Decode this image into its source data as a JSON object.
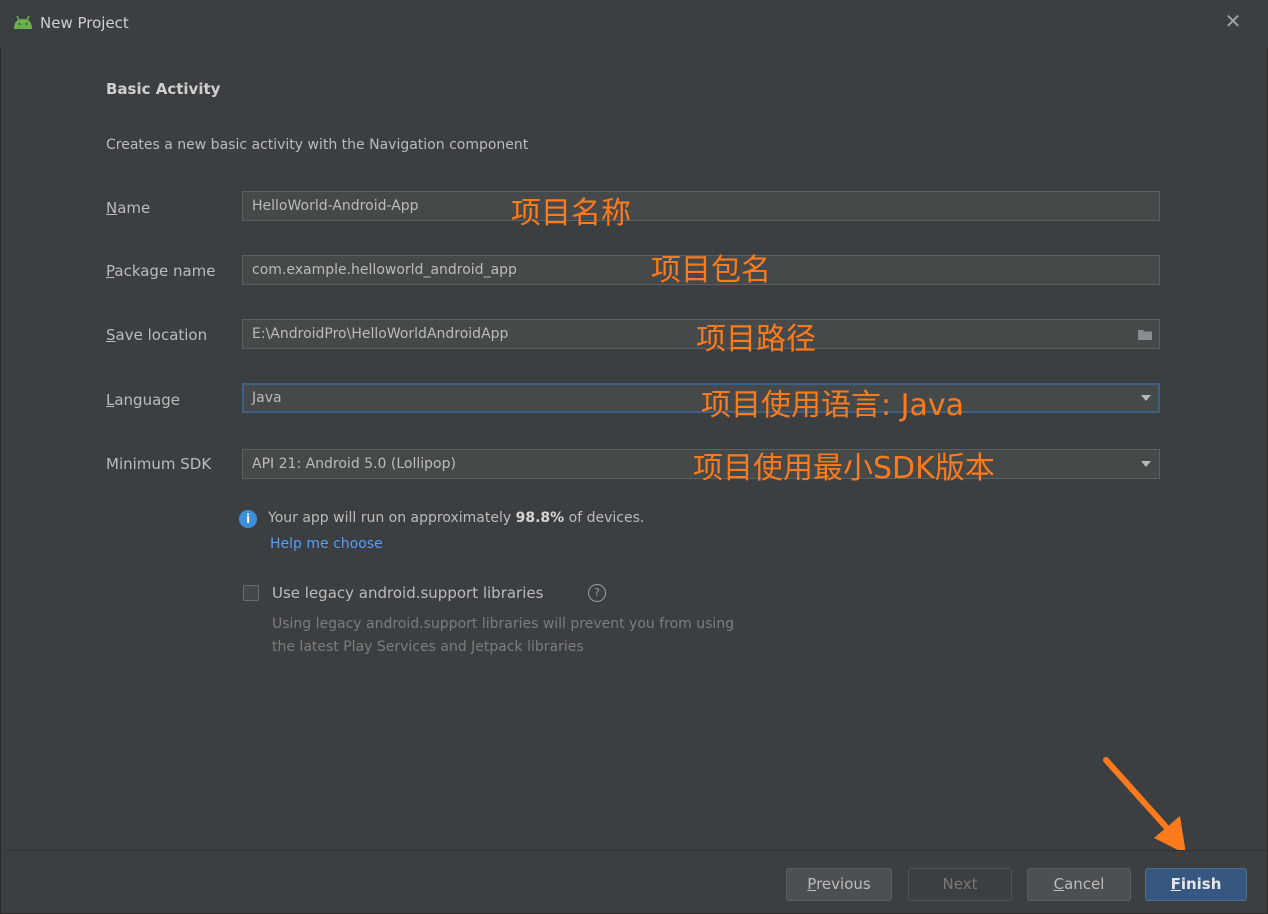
{
  "window": {
    "title": "New Project",
    "close_glyph": "✕"
  },
  "header": {
    "section_title": "Basic Activity",
    "description": "Creates a new basic activity with the Navigation component"
  },
  "form": {
    "name": {
      "label_key": "N",
      "label_rest": "ame",
      "value": "HelloWorld-Android-App"
    },
    "package": {
      "label_key": "P",
      "label_rest": "ackage name",
      "value": "com.example.helloworld_android_app"
    },
    "save_location": {
      "label_key": "S",
      "label_rest": "ave location",
      "value": "E:\\AndroidPro\\HelloWorldAndroidApp"
    },
    "language": {
      "label_key": "L",
      "label_rest": "anguage",
      "value": "Java"
    },
    "min_sdk": {
      "label": "Minimum SDK",
      "value": "API 21: Android 5.0 (Lollipop)"
    }
  },
  "info": {
    "icon": "info-icon",
    "text_before": "Your app will run on approximately ",
    "percent": "98.8%",
    "text_after": " of devices.",
    "help_link": "Help me choose"
  },
  "legacy": {
    "checked": false,
    "label": "Use legacy android.support libraries",
    "help_glyph": "?",
    "hint_line1": "Using legacy android.support libraries will prevent you from using",
    "hint_line2": "the latest Play Services and Jetpack libraries"
  },
  "annotations": {
    "name": "项目名称",
    "package": "项目包名",
    "location": "项目路径",
    "language": "项目使用语言: Java",
    "sdk": "项目使用最小SDK版本",
    "color": "#ff7a1a"
  },
  "buttons": {
    "previous_key": "P",
    "previous_rest": "revious",
    "next": "Next",
    "cancel_key": "C",
    "cancel_rest": "ancel",
    "finish_key": "F",
    "finish_rest": "inish"
  },
  "colors": {
    "background": "#3c3f41",
    "field_bg": "#45494a",
    "focus_border": "#3d6185",
    "link": "#589df6",
    "primary_button": "#365880"
  }
}
